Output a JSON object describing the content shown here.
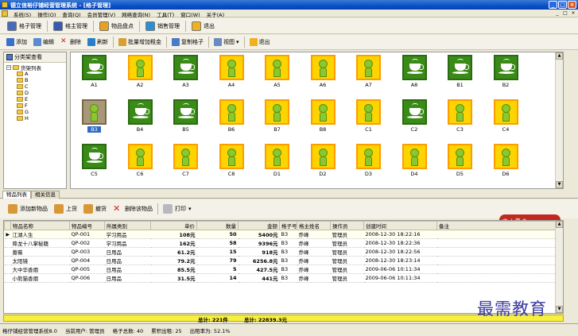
{
  "window": {
    "title": "德立信裕仔铺经营管理系统 - [格子管理]"
  },
  "menu": {
    "items": [
      "系统(S)",
      "操作(O)",
      "查询(Q)",
      "会员管理(V)",
      "网络查询(N)",
      "工具(T)",
      "窗口(W)",
      "关于(A)"
    ]
  },
  "toolbar_main": {
    "grid_mgmt": "格子管理",
    "owner_mgmt": "格主管理",
    "inventory": "物品盘点",
    "sales_mgmt": "销售管理",
    "exit": "退出"
  },
  "toolbar_grid": {
    "add": "添加",
    "edit": "编辑",
    "delete": "删除",
    "refresh": "刷新",
    "batch_rent": "批量增加租金",
    "copy_grid": "复制格子",
    "view": "视图",
    "exit": "退出"
  },
  "left_panel": {
    "tab_label": "分类架查看",
    "tree_root": "货架列表",
    "tree_children": [
      "A",
      "B",
      "C",
      "D",
      "E",
      "F",
      "G",
      "H"
    ]
  },
  "grid_cells": [
    {
      "label": "A1",
      "state": "used"
    },
    {
      "label": "A2",
      "state": "free"
    },
    {
      "label": "A3",
      "state": "used"
    },
    {
      "label": "A4",
      "state": "free"
    },
    {
      "label": "A5",
      "state": "free"
    },
    {
      "label": "A6",
      "state": "free"
    },
    {
      "label": "A7",
      "state": "free"
    },
    {
      "label": "A8",
      "state": "used"
    },
    {
      "label": "B1",
      "state": "used"
    },
    {
      "label": "B2",
      "state": "used"
    },
    {
      "label": "B3",
      "state": "selected"
    },
    {
      "label": "B4",
      "state": "used"
    },
    {
      "label": "B5",
      "state": "used"
    },
    {
      "label": "B6",
      "state": "free"
    },
    {
      "label": "B7",
      "state": "free"
    },
    {
      "label": "B8",
      "state": "free"
    },
    {
      "label": "C1",
      "state": "free"
    },
    {
      "label": "C2",
      "state": "used"
    },
    {
      "label": "C3",
      "state": "free"
    },
    {
      "label": "C4",
      "state": "free"
    },
    {
      "label": "C5",
      "state": "used"
    },
    {
      "label": "C6",
      "state": "free"
    },
    {
      "label": "C7",
      "state": "free"
    },
    {
      "label": "C8",
      "state": "free"
    },
    {
      "label": "D1",
      "state": "free"
    },
    {
      "label": "D2",
      "state": "free"
    },
    {
      "label": "D3",
      "state": "free"
    },
    {
      "label": "D4",
      "state": "free"
    },
    {
      "label": "D5",
      "state": "free"
    },
    {
      "label": "D6",
      "state": "free"
    }
  ],
  "bottom_tabs": [
    "物品列表",
    "相关信息"
  ],
  "toolbar_items": {
    "add_item": "添加新物品",
    "up_shelf": "上货",
    "down_shelf": "撤货",
    "delete_item": "删除该物品",
    "print": "打印"
  },
  "float_panel": {
    "text": "中 ↓ 简 ⚙"
  },
  "table": {
    "headers": [
      "物品名称",
      "物品编号",
      "所属类别",
      "单价",
      "数量",
      "金额",
      "格子号",
      "格主姓名",
      "操作员",
      "创建时间",
      "备注"
    ],
    "rows": [
      [
        "江湖人生",
        "QP-001",
        "学习用品",
        "108元",
        "50",
        "5400元",
        "B3",
        "乔峰",
        "管理员",
        "2008-12-30 18:22:16",
        ""
      ],
      [
        "降龙十八掌秘籍",
        "QP-002",
        "学习用品",
        "162元",
        "58",
        "9396元",
        "B3",
        "乔峰",
        "管理员",
        "2008-12-30 18:22:36",
        ""
      ],
      [
        "蔷薇",
        "QP-003",
        "日用品",
        "61.2元",
        "15",
        "918元",
        "B3",
        "乔峰",
        "管理员",
        "2008-12-30 18:22:56",
        ""
      ],
      [
        "太阳镜",
        "QP-004",
        "日用品",
        "79.2元",
        "79",
        "6256.8元",
        "B3",
        "乔峰",
        "管理员",
        "2008-12-30 18:23:14",
        ""
      ],
      [
        "大中华香烟",
        "QP-005",
        "日用品",
        "85.5元",
        "5",
        "427.5元",
        "B3",
        "乔峰",
        "管理员",
        "2009-06-06 10:11:34",
        ""
      ],
      [
        "小熊猫香烟",
        "QP-006",
        "日用品",
        "31.5元",
        "14",
        "441元",
        "B3",
        "乔峰",
        "管理员",
        "2009-06-06 10:11:34",
        ""
      ]
    ]
  },
  "totals": {
    "count": "总计: 221件",
    "amount": "总计: 22839.3元"
  },
  "status": {
    "app_name": "格仔铺经营管理系统8.0",
    "current_user": "当前用户: 管理员",
    "grid_total": "格子总数: 40",
    "rented": "累积出租: 25",
    "rent_rate": "出租率为: 52.1%"
  },
  "watermark": "最需教育",
  "colors": {
    "free_tile": "#fcd400",
    "used_tile": "#3a8a18",
    "selected_tile": "#a89878",
    "totals_bar": "#f8f040"
  }
}
